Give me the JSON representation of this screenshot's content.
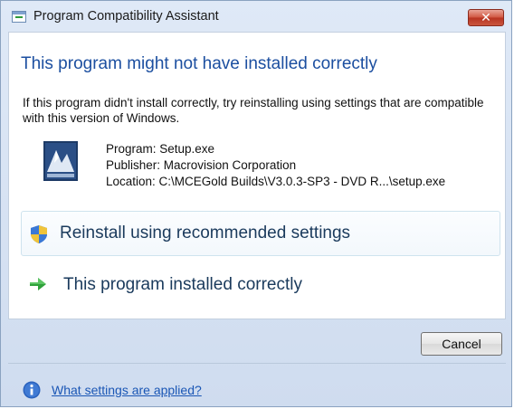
{
  "window": {
    "title": "Program Compatibility Assistant",
    "close_label": "✕"
  },
  "dialog": {
    "headline": "This program might not have installed correctly",
    "body": "If this program didn't install correctly, try reinstalling using settings that are compatible with this version of Windows.",
    "program": {
      "program_line": "Program: Setup.exe",
      "publisher_line": "Publisher: Macrovision Corporation",
      "location_line": "Location: C:\\MCEGold Builds\\V3.0.3-SP3 - DVD R...\\setup.exe"
    },
    "options": [
      {
        "label": "Reinstall using recommended settings",
        "icon": "shield-icon"
      },
      {
        "label": "This program installed correctly",
        "icon": "green-arrow-icon"
      }
    ],
    "cancel_label": "Cancel",
    "help_link": "What settings are applied?"
  },
  "colors": {
    "headline": "#1c4fa0",
    "link": "#1a56b5",
    "close_button": "#c9553e"
  }
}
